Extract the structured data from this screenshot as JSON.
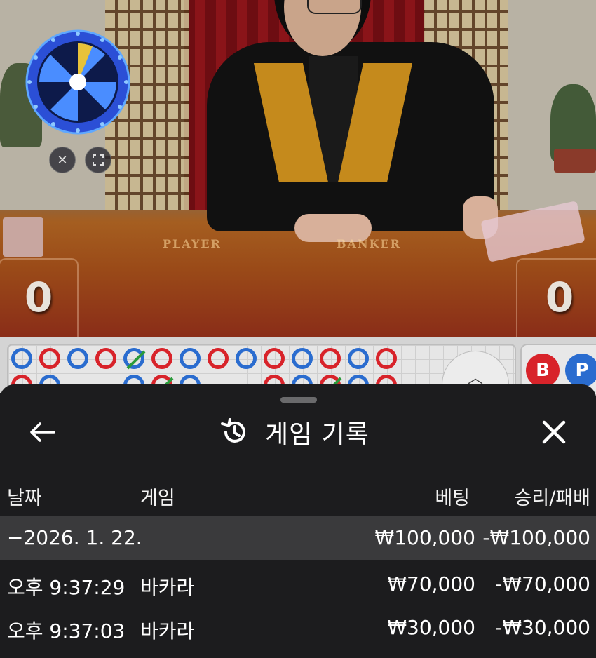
{
  "video": {
    "table_left_label": "PLAYER",
    "table_right_label": "BANKER",
    "player_score": "0",
    "banker_score": "0"
  },
  "roadmap": {
    "row1": [
      "P",
      "B",
      "P",
      "B",
      "P",
      "B",
      "P",
      "B",
      "P",
      "B",
      "P",
      "B",
      "P",
      "B"
    ],
    "row1_ties": [
      4
    ],
    "row2": [
      "B",
      "P",
      "",
      "",
      "P",
      "B",
      "P",
      "",
      "",
      "B",
      "P",
      "B",
      "P",
      "B"
    ],
    "row2_ties": [
      5,
      11
    ],
    "prediction_b": "B",
    "prediction_p": "P",
    "colors": {
      "banker": "#d8232a",
      "player": "#2a6ccf",
      "tie": "#2a9a3a"
    }
  },
  "sheet": {
    "title": "게임 기록",
    "columns": {
      "date": "날짜",
      "game": "게임",
      "bet": "베팅",
      "winloss": "승리/패배"
    },
    "date_group": {
      "date": "−2026. 1. 22.",
      "bet": "₩100,000",
      "winloss": "-₩100,000"
    },
    "rows": [
      {
        "time": "오후 9:37:29",
        "game": "바카라",
        "bet": "₩70,000",
        "winloss": "-₩70,000"
      },
      {
        "time": "오후 9:37:03",
        "game": "바카라",
        "bet": "₩30,000",
        "winloss": "-₩30,000"
      }
    ]
  }
}
